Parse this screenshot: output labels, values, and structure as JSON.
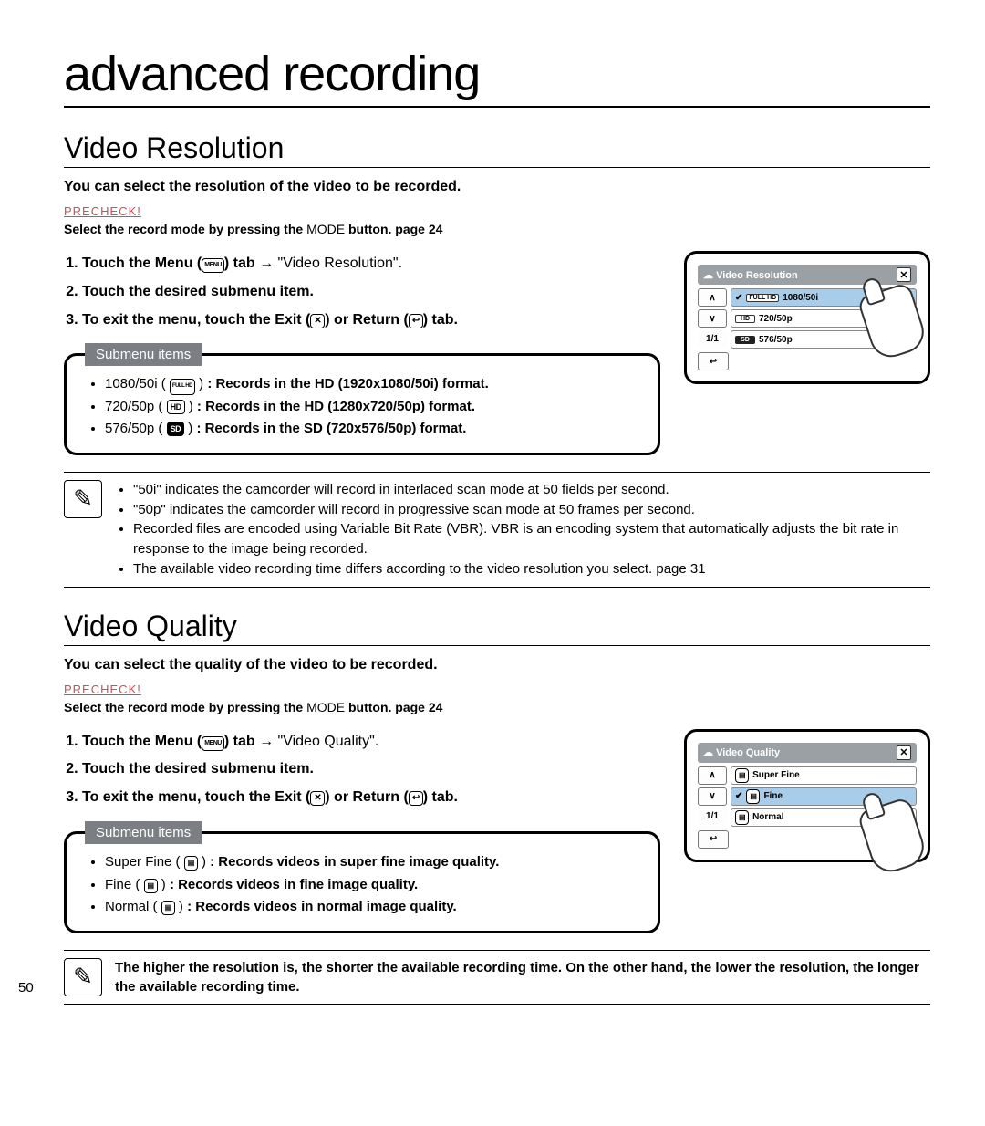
{
  "page_number": "50",
  "title": "advanced recording",
  "sections": [
    {
      "heading": "Video Resolution",
      "intro": "You can select the resolution of the video to be recorded.",
      "precheck_label": "PRECHECK!",
      "precheck_text_a": "Select the record mode by pressing the ",
      "precheck_text_mode": "MODE",
      "precheck_text_b": " button. ",
      "precheck_text_c": "page 24",
      "steps": [
        {
          "a": "Touch the Menu (",
          "b": ") tab ",
          "c": "→",
          "d": " \"Video Resolution\"."
        },
        {
          "a": "Touch the desired submenu item."
        },
        {
          "a": "To exit the menu, touch the Exit (",
          "b": ") or Return (",
          "c": ") tab."
        }
      ],
      "submenu_label": "Submenu items",
      "submenu": [
        {
          "name": "1080/50i",
          "desc": ": Records in the HD (1920x1080/50i) format."
        },
        {
          "name": "720/50p",
          "desc": ": Records in the HD (1280x720/50p) format."
        },
        {
          "name": "576/50p",
          "desc": ": Records in the SD (720x576/50p) format."
        }
      ],
      "notes": [
        "\"50i\" indicates the camcorder will record in interlaced scan mode at 50 fields per second.",
        "\"50p\" indicates the camcorder will record in progressive scan mode at 50 frames per second.",
        "Recorded files are encoded using Variable Bit Rate (VBR). VBR is an encoding system that automatically adjusts the bit rate in response to the image being recorded.",
        "The available video recording time differs according to the video resolution you select. page 31"
      ],
      "screen": {
        "title": "Video Resolution",
        "pager": "1/1",
        "items": [
          {
            "label": "1080/50i",
            "badge": "FULL HD",
            "sel": true,
            "check": true
          },
          {
            "label": "720/50p",
            "badge": "HD",
            "sel": false,
            "check": false
          },
          {
            "label": "576/50p",
            "badge": "SD",
            "sel": false,
            "check": false,
            "dark": true
          }
        ]
      }
    },
    {
      "heading": "Video Quality",
      "intro": "You can select the quality of the video to be recorded.",
      "precheck_label": "PRECHECK!",
      "precheck_text_a": "Select the record mode by pressing the ",
      "precheck_text_mode": "MODE",
      "precheck_text_b": " button. ",
      "precheck_text_c": "page 24",
      "steps": [
        {
          "a": "Touch the Menu (",
          "b": ") tab ",
          "c": "→",
          "d": " \"Video Quality\"."
        },
        {
          "a": "Touch the desired submenu item."
        },
        {
          "a": "To exit the menu, touch the Exit (",
          "b": ") or Return (",
          "c": ") tab."
        }
      ],
      "submenu_label": "Submenu items",
      "submenu": [
        {
          "name": "Super Fine",
          "desc": ": Records videos in super fine image quality."
        },
        {
          "name": "Fine",
          "desc": ": Records videos in fine image quality."
        },
        {
          "name": "Normal",
          "desc": ": Records videos in normal image quality."
        }
      ],
      "note_single": "The higher the resolution is, the shorter the available recording time. On the other hand, the lower the resolution, the longer the available recording time.",
      "screen": {
        "title": "Video Quality",
        "pager": "1/1",
        "items": [
          {
            "label": "Super Fine",
            "sel": false,
            "check": false
          },
          {
            "label": "Fine",
            "sel": true,
            "check": true
          },
          {
            "label": "Normal",
            "sel": false,
            "check": false
          }
        ]
      }
    }
  ],
  "icons": {
    "menu_label": "MENU",
    "fullhd_label": "FULL\nHD"
  }
}
